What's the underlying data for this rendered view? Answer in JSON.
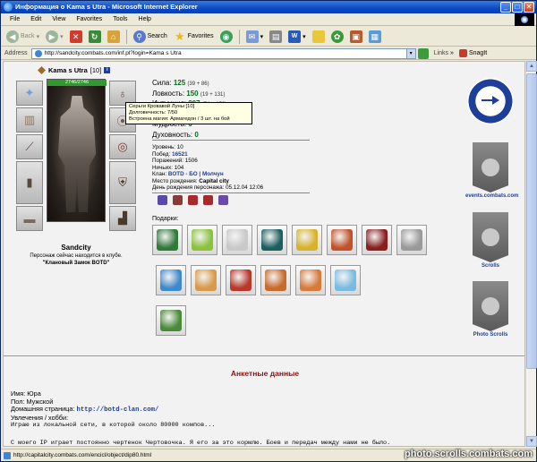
{
  "window": {
    "title": "Информация о Kama s Utra - Microsoft Internet Explorer",
    "buttons": [
      "_",
      "□",
      "✕"
    ]
  },
  "menubar": [
    "File",
    "Edit",
    "View",
    "Favorites",
    "Tools",
    "Help"
  ],
  "toolbar": {
    "back": "Back",
    "search": "Search",
    "favorites": "Favorites"
  },
  "addressbar": {
    "label": "Address",
    "url": "http://sandcity.combats.com/inf.pl?login=Kama s Utra",
    "links": "Links",
    "snagit": "SnagIt"
  },
  "character": {
    "name": "Kama s Utra",
    "level": "[10]",
    "info_badge": "i",
    "hp": "2746/2746",
    "city": "Sandcity",
    "location_line1": "Персонаж сейчас находится в клубе.",
    "location_line2": "\"Клановый Замок BOTD\""
  },
  "tooltip": {
    "line1": "Серьги Кровавой Луны [10]",
    "line2": "Долговечность: 7/50",
    "line3": "Встроена магия: Армагедон / 3 шт. на бой"
  },
  "stats": [
    {
      "label": "Сила:",
      "value": "125",
      "bonus": "(39 + 86)",
      "bonus_hl": false
    },
    {
      "label": "Ловкость:",
      "value": "150",
      "bonus": "(19 + 131)",
      "bonus_hl": false
    },
    {
      "label": "Интуиция:",
      "value": "207",
      "bonus": "(54 + 153)",
      "bonus_hl": false
    },
    {
      "label": "Выносливость:",
      "value": "",
      "bonus": "",
      "bonus_hl": false
    },
    {
      "label": "Мудрость:",
      "value": "0",
      "bonus": "",
      "bonus_hl": false
    },
    {
      "label": "Духовность:",
      "value": "0",
      "bonus": "",
      "bonus_hl": false
    }
  ],
  "details": {
    "level": "Уровень: 10",
    "wins_label": "Побед: ",
    "wins": "16521",
    "losses": "Поражений: 1506",
    "draws": "Ничьих: 104",
    "clan_label": "Клан: ",
    "clan": "BOTD - БО | Молчун",
    "birthplace_label": "Место рождения: ",
    "birthplace": "Capital city",
    "birthday_label": "День рождения персонажа: ",
    "birthday": "05.12.04 12:06"
  },
  "badge_colors": [
    "#5a4aa8",
    "#8a3a3a",
    "#a82a2a",
    "#a82a2a",
    "#6a4aa8"
  ],
  "gifts_label": "Подарки:",
  "gifts_row1": [
    "#2f7a3a",
    "#8ac23c",
    "#c9c9c9",
    "#1c5f5f",
    "#d8b22a",
    "#c2522a",
    "#8a1f1f",
    "#9a9a9a"
  ],
  "gifts_row2": [
    "#3f8acb",
    "#d89a4a",
    "#b8382a",
    "#c86a2a",
    "#d87a3a",
    "#7abce0"
  ],
  "gifts_row3": [
    "#4a8a3a"
  ],
  "sidebar": {
    "events_link": "events.combats.com",
    "scrolls_link": "Scrolls",
    "photo_scrolls_link": "Photo Scrolls"
  },
  "profile": {
    "section_title": "Анкетные данные",
    "name": "Имя: Юра",
    "sex": "Пол: Мужской",
    "homepage_label": "Домашняя страница: ",
    "homepage": "http://botd-clan.com/",
    "hobby_label": "Увлечения / хобби:",
    "hobby_line": "Играю из локальной сети, в которой около 80000 компов...",
    "footer_line": "С моего IP играет постоянно чертенок Чертовочка. Я его за это кормлю. Боев и передач между нами не было."
  },
  "statusbar": {
    "text": "http://capitalcity.combats.com/encicl/object/dip80.html",
    "watermark": "photo.scrolls.combats.com"
  }
}
